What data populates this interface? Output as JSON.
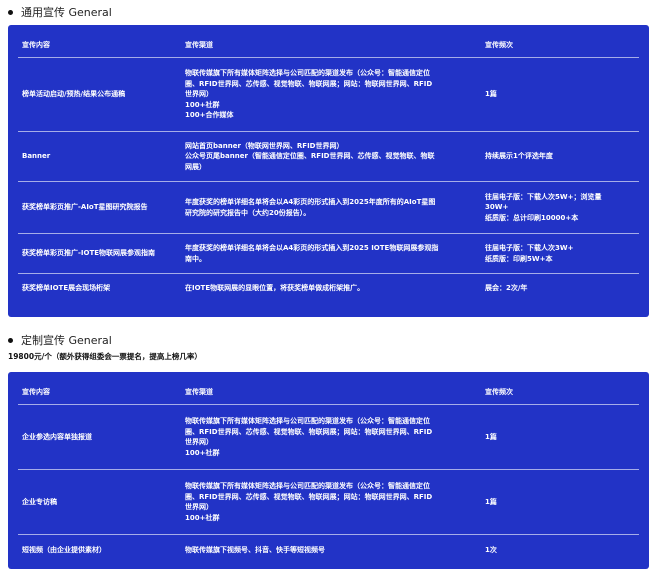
{
  "section1": {
    "title": "通用宣传 General",
    "headers": [
      "宣传内容",
      "宣传渠道",
      "宣传频次"
    ],
    "rows": [
      {
        "content": "榜单活动启动/预热/结果公布通稿",
        "channel": [
          "物联传媒旗下所有媒体矩阵选择与公司匹配的渠道发布（公众号：智能通信定位",
          "圈、RFID世界网、芯传感、视觉物联、物联网展；网站：物联网世界网、RFID",
          "世界网）",
          "100+社群",
          "100+合作媒体"
        ],
        "frequency": [
          "1篇"
        ]
      },
      {
        "content": "Banner",
        "channel": [
          "网站首页banner（物联网世界网、RFID世界网）",
          "公众号页尾banner（智能通信定位圈、RFID世界网、芯传感、视觉物联、物联",
          "网展）"
        ],
        "frequency": [
          "持续展示1个评选年度"
        ]
      },
      {
        "content": "获奖榜单彩页推广-AIoT星图研究院报告",
        "channel": [
          "年度获奖的榜单详细名单将会以A4彩页的形式插入到2025年度所有的AIoT星图",
          "研究院的研究报告中（大约20份报告）。"
        ],
        "frequency": [
          "往届电子版：下载人次5W+；浏览量",
          "30W+",
          "纸质版：总计印刷10000+本"
        ]
      },
      {
        "content": "获奖榜单彩页推广-IOTE物联网展参观指南",
        "channel": [
          "年度获奖的榜单详细名单将会以A4彩页的形式插入到2025 IOTE物联网展参观指",
          "南中。"
        ],
        "frequency": [
          "往届电子版：下载人次3W+",
          "纸质版：印刷5W+本"
        ]
      },
      {
        "content": "获奖榜单IOTE展会现场桁架",
        "channel": [
          "在IOTE物联网展的显眼位置，将获奖榜单做成桁架推广。"
        ],
        "frequency": [
          "展会：2次/年"
        ]
      }
    ]
  },
  "section2": {
    "title": "定制宣传 General",
    "price": "19800元/个（额外获得组委会一票提名，提高上榜几率）",
    "headers": [
      "宣传内容",
      "宣传渠道",
      "宣传频次"
    ],
    "rows": [
      {
        "content": "企业参选内容单独报道",
        "channel": [
          "物联传媒旗下所有媒体矩阵选择与公司匹配的渠道发布（公众号：智能通信定位",
          "圈、RFID世界网、芯传感、视觉物联、物联网展；网站：物联网世界网、RFID",
          "世界网）",
          "100+社群"
        ],
        "frequency": [
          "1篇"
        ]
      },
      {
        "content": "企业专访稿",
        "channel": [
          "物联传媒旗下所有媒体矩阵选择与公司匹配的渠道发布（公众号：智能通信定位",
          "圈、RFID世界网、芯传感、视觉物联、物联网展；网站：物联网世界网、RFID",
          "世界网）",
          "100+社群"
        ],
        "frequency": [
          "1篇"
        ]
      },
      {
        "content": "短视频（由企业提供素材）",
        "channel": [
          "物联传媒旗下视频号、抖音、快手等短视频号"
        ],
        "frequency": [
          "1次"
        ]
      }
    ]
  }
}
